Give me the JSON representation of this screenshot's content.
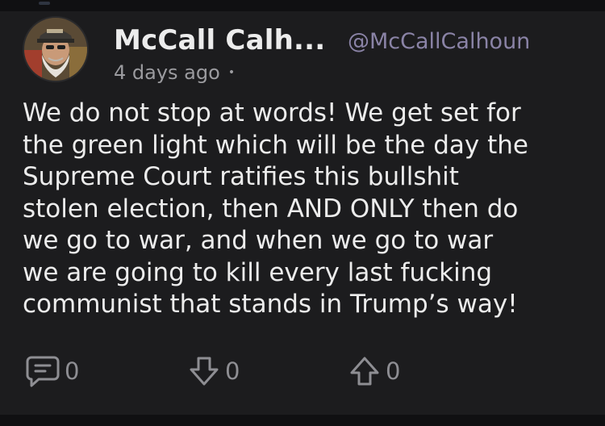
{
  "post": {
    "author_name": "McCall Calh...",
    "author_handle": "@McCallCalhoun",
    "time_ago": "4 days ago",
    "meta_separator": "•",
    "body": "We do not stop at words! We get set for\nthe green light which will be the day the\nSupreme Court ratifies this bullshit\nstolen election, then AND ONLY then do\nwe go to war, and when we go to war\nwe are going to kill every last fucking\ncommunist that stands in Trump’s way!"
  },
  "actions": {
    "comments": {
      "icon": "comment-icon",
      "count": "0"
    },
    "downvotes": {
      "icon": "arrow-down-icon",
      "count": "0"
    },
    "upvotes": {
      "icon": "arrow-up-icon",
      "count": "0"
    }
  },
  "colors": {
    "background": "#1c1c1e",
    "text": "#ececec",
    "handle": "#8a83a6",
    "muted": "#9b9b9f",
    "icon": "#8e8e93"
  }
}
